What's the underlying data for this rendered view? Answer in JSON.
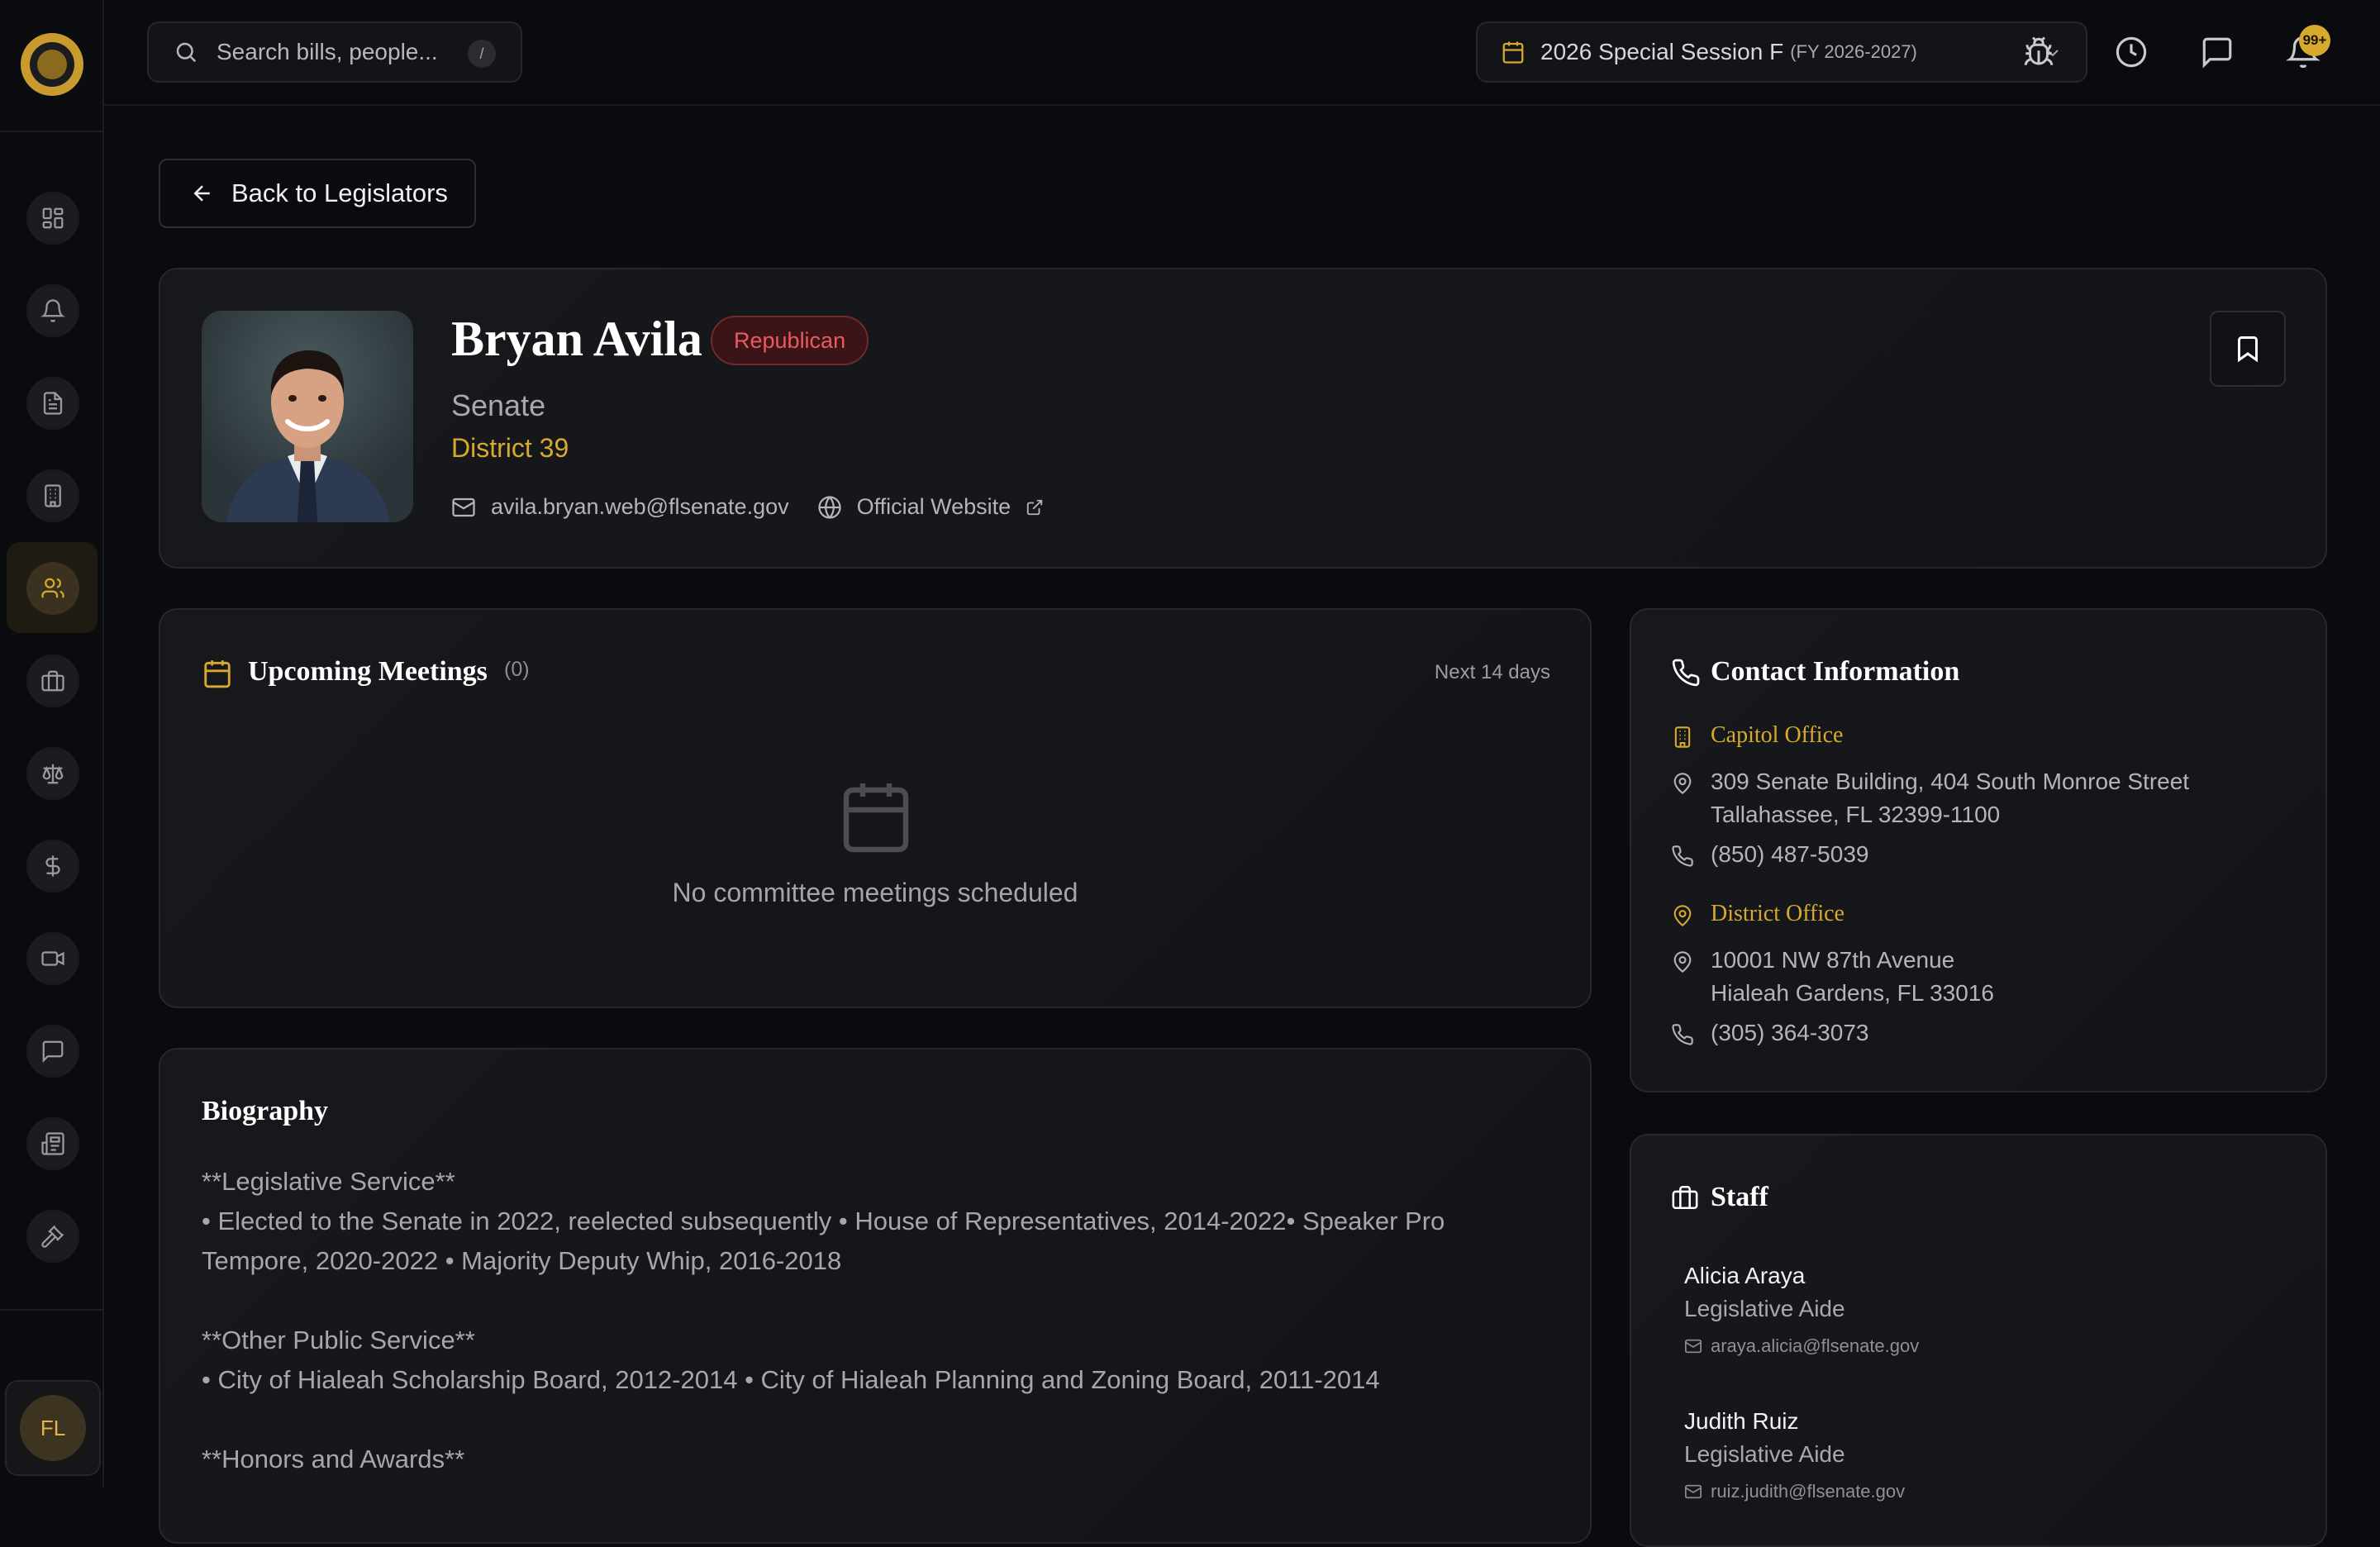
{
  "search": {
    "placeholder": "Search bills, people...",
    "shortcut": "/"
  },
  "session": {
    "name": "2026 Special Session F",
    "fiscal_year": "(FY 2026-2027)"
  },
  "notifications": {
    "badge": "99+"
  },
  "user": {
    "initials": "FL"
  },
  "back_button": {
    "label": "Back to Legislators"
  },
  "legislator": {
    "name": "Bryan Avila",
    "party": "Republican",
    "chamber": "Senate",
    "district": "District 39",
    "email": "avila.bryan.web@flsenate.gov",
    "website_label": "Official Website"
  },
  "meetings": {
    "title": "Upcoming Meetings",
    "count": "(0)",
    "range": "Next 14 days",
    "empty": "No committee meetings scheduled"
  },
  "biography": {
    "title": "Biography",
    "text": "**Legislative Service**\n• Elected to the Senate in 2022, reelected subsequently • House of Representatives, 2014-2022• Speaker Pro Tempore, 2020-2022 • Majority Deputy Whip, 2016-2018\n\n**Other Public Service**\n• City of Hialeah Scholarship Board, 2012-2014 • City of Hialeah Planning and Zoning Board, 2011-2014\n\n**Honors and Awards**"
  },
  "contact": {
    "title": "Contact Information",
    "capitol": {
      "label": "Capitol Office",
      "address1": "309 Senate Building, 404 South Monroe Street",
      "address2": "Tallahassee, FL 32399-1100",
      "phone": "(850) 487-5039"
    },
    "district_office": {
      "label": "District Office",
      "address1": "10001 NW 87th Avenue",
      "address2": "Hialeah Gardens, FL 33016",
      "phone": "(305) 364-3073"
    }
  },
  "staff": {
    "title": "Staff",
    "members": [
      {
        "name": "Alicia Araya",
        "role": "Legislative Aide",
        "email": "araya.alicia@flsenate.gov"
      },
      {
        "name": "Judith Ruiz",
        "role": "Legislative Aide",
        "email": "ruiz.judith@flsenate.gov"
      }
    ]
  },
  "colors": {
    "accent": "#d7a92c",
    "party_red": "#ec5a5e",
    "background": "#0a0b0e"
  }
}
